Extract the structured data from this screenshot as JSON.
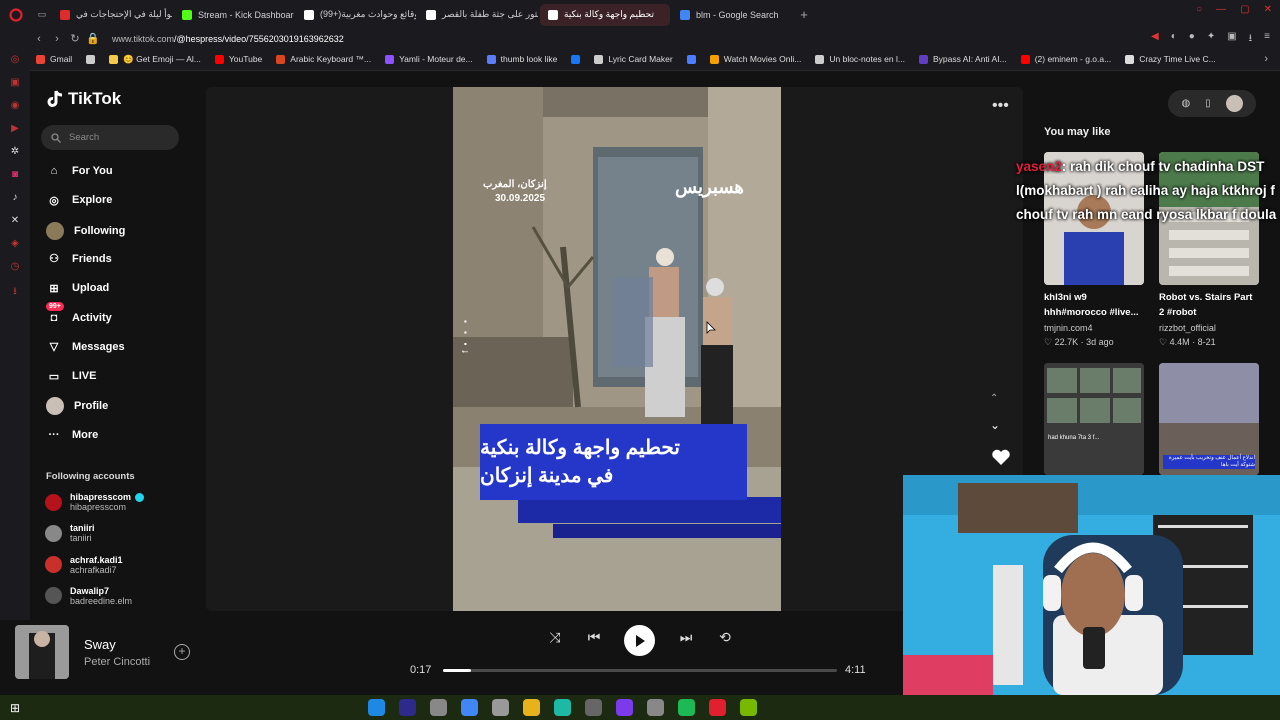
{
  "browser": {
    "tabs": [
      {
        "label": "أسوأ ليلة في الإحتجاجات في",
        "active": false,
        "color": "#e02b2b"
      },
      {
        "label": "Stream - Kick Dashboard",
        "active": false,
        "color": "#53fc18"
      },
      {
        "label": "(99+)وقائع وحوادث مغربية",
        "active": false,
        "color": "#ffffff"
      },
      {
        "label": "العثور على جثة طفلة بالقصر",
        "active": false,
        "color": "#ffffff"
      },
      {
        "label": "تحطيم واجهة وكالة بنكية",
        "active": true,
        "color": "#ffffff"
      },
      {
        "label": "blm - Google Search",
        "active": false,
        "color": "#4285f4"
      }
    ],
    "url_prefix": "www.tiktok.com",
    "url_path": "/@hespress/video/7556203019163962632",
    "bookmarks": [
      {
        "label": "Gmail",
        "color": "#ea4335"
      },
      {
        "label": "",
        "color": "#cccccc"
      },
      {
        "label": "😊 Get Emoji — Al...",
        "color": "#f7c948"
      },
      {
        "label": "YouTube",
        "color": "#ff0000"
      },
      {
        "label": "Arabic Keyboard ™...",
        "color": "#d9461f"
      },
      {
        "label": "Yamli - Moteur de...",
        "color": "#8c52ff"
      },
      {
        "label": "thumb look like",
        "color": "#5c7cfa"
      },
      {
        "label": "",
        "color": "#1877f2"
      },
      {
        "label": "Lyric Card Maker",
        "color": "#cccccc"
      },
      {
        "label": "",
        "color": "#4a7dff"
      },
      {
        "label": "Watch Movies Onli...",
        "color": "#f59f00"
      },
      {
        "label": "Un bloc-notes en l...",
        "color": "#cccccc"
      },
      {
        "label": "Bypass AI: Anti AI...",
        "color": "#5f3dc4"
      },
      {
        "label": "(2) eminem - g.o.a...",
        "color": "#ff0000"
      },
      {
        "label": "Crazy Time Live C...",
        "color": "#dddddd"
      }
    ]
  },
  "tiktok": {
    "logo": "TikTok",
    "search_placeholder": "Search",
    "nav": [
      {
        "label": "For You",
        "icon": "home-icon"
      },
      {
        "label": "Explore",
        "icon": "compass-icon"
      },
      {
        "label": "Following",
        "icon": "avatar-icon"
      },
      {
        "label": "Friends",
        "icon": "friends-icon"
      },
      {
        "label": "Upload",
        "icon": "plus-square-icon"
      },
      {
        "label": "Activity",
        "icon": "bell-icon",
        "badge": "99+"
      },
      {
        "label": "Messages",
        "icon": "paper-plane-icon"
      },
      {
        "label": "LIVE",
        "icon": "live-icon"
      },
      {
        "label": "Profile",
        "icon": "profile-avatar-icon"
      },
      {
        "label": "More",
        "icon": "ellipsis-icon"
      }
    ],
    "following_title": "Following accounts",
    "accounts": [
      {
        "name": "hibapresscom",
        "handle": "hibapresscom",
        "verified": true
      },
      {
        "name": "taniiri",
        "handle": "taniiri",
        "verified": false
      },
      {
        "name": "achraf.kadi1",
        "handle": "achrafkadi7",
        "verified": false
      },
      {
        "name": "Dawalip7",
        "handle": "badreedine.elm",
        "verified": false
      }
    ]
  },
  "video": {
    "watermark": "هسبريس",
    "location": "إنزكان، المغرب",
    "date": "30.09.2025",
    "headline_line1": "تحطيم واجهة وكالة بنكية",
    "headline_line2": "في مدينة إنزكان",
    "side_text": "f ▪ ▪ ▪"
  },
  "suggestions": {
    "title": "You may like",
    "items": [
      {
        "caption_l1": "khl3ni w9",
        "caption_l2": "hhh#morocco #live...",
        "author": "tmjnin.com4",
        "likes": "22.7K",
        "age": "3d ago"
      },
      {
        "caption_l1": "Robot vs. Stairs Part",
        "caption_l2": "2 #robot",
        "author": "rizzbot_official",
        "likes": "4.4M",
        "age": "8-21"
      }
    ],
    "thumb3_caption": "had khuna 7ta 3 f...",
    "thumb4_caption": "اندلاع أعمال عنف وتخريب بأيت عميرة شتوكة أيت باها"
  },
  "chat_overlay": {
    "username": "yasen2",
    "message": ": rah dik chouf tv chadinha DST l(mokhabart ) rah ealiha ay haja ktkhroj f chouf tv rah mn eand ryosa lkbar f doula"
  },
  "player": {
    "song": "Sway",
    "artist": "Peter Cincotti",
    "current_time": "0:17",
    "total_time": "4:11",
    "progress_percent": 7
  }
}
